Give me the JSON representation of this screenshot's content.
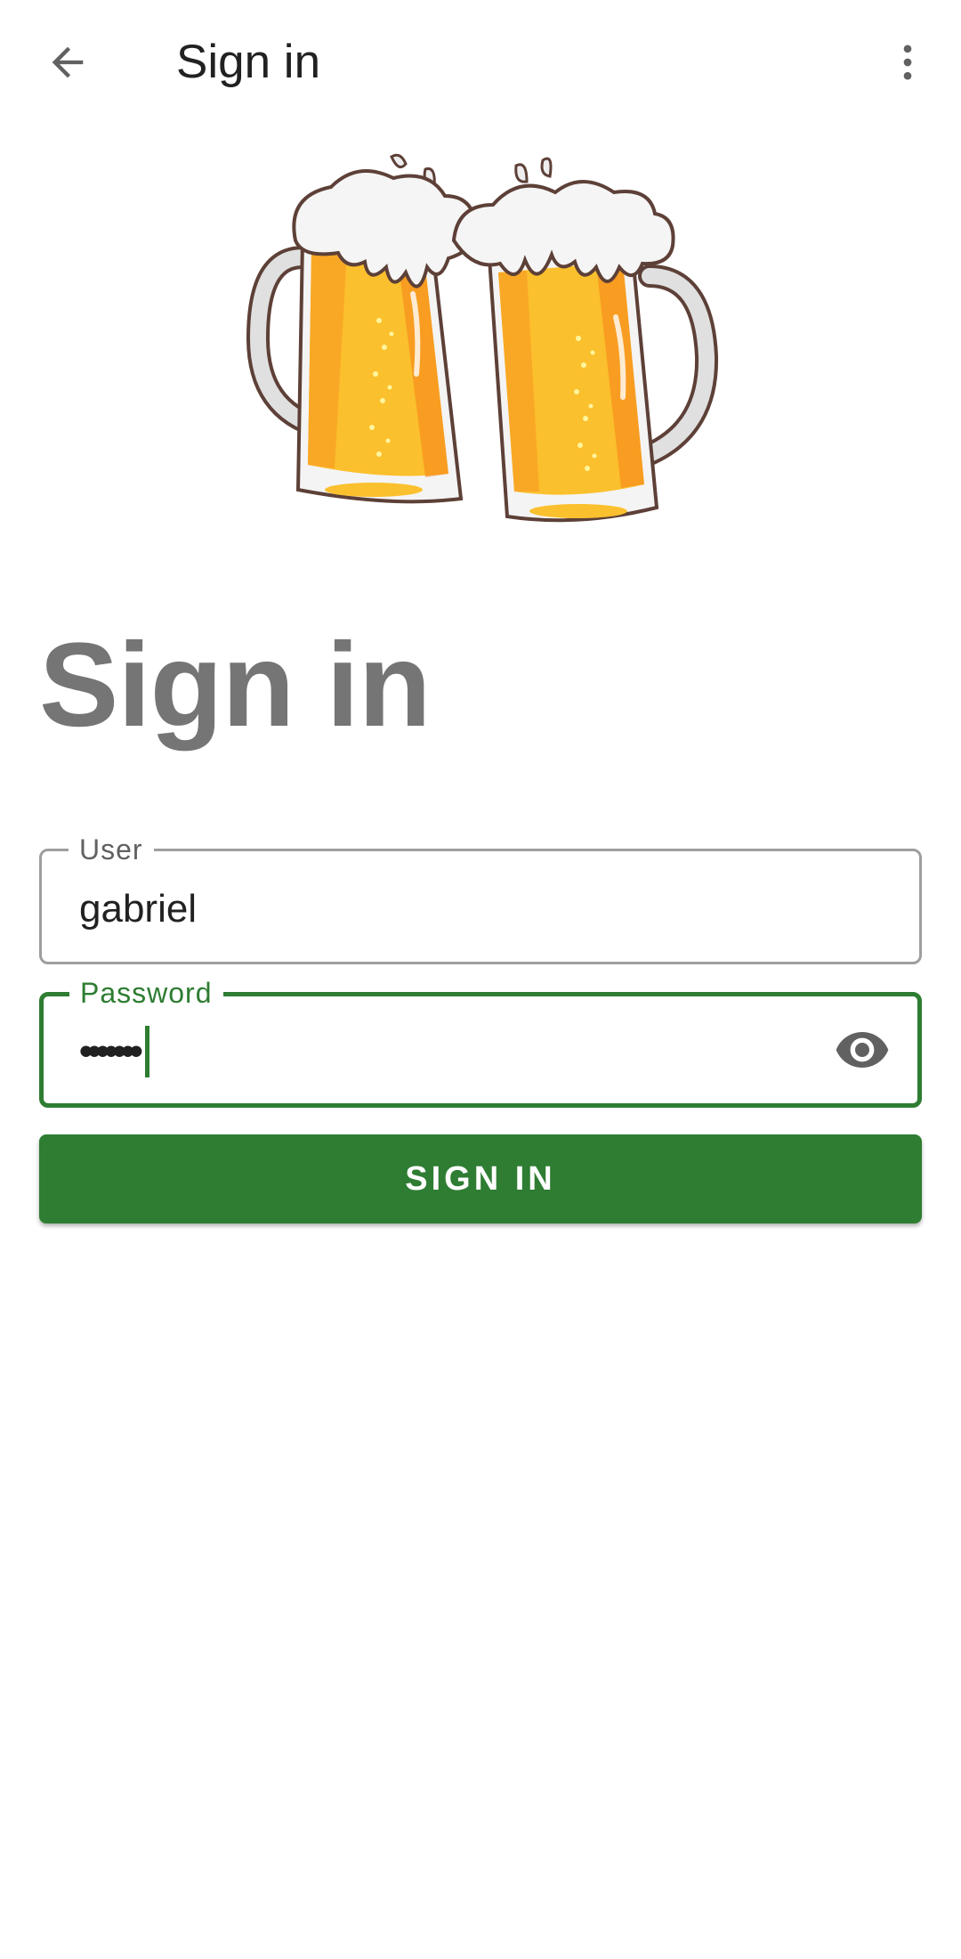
{
  "app_bar": {
    "title": "Sign in",
    "back_icon": "arrow-back-icon",
    "menu_icon": "more-vert-icon"
  },
  "logo": {
    "icon": "beer-mugs-cheers-illustration"
  },
  "heading": "Sign in",
  "form": {
    "user": {
      "label": "User",
      "value": "gabriel"
    },
    "password": {
      "label": "Password",
      "masked_value": "•••••••",
      "toggle_icon": "eye-icon"
    },
    "submit_label": "SIGN IN"
  },
  "colors": {
    "primary": "#2e7d32",
    "heading": "#757575",
    "outline": "#9e9e9e",
    "beer": "#f9a825",
    "foam": "#ffffff"
  }
}
